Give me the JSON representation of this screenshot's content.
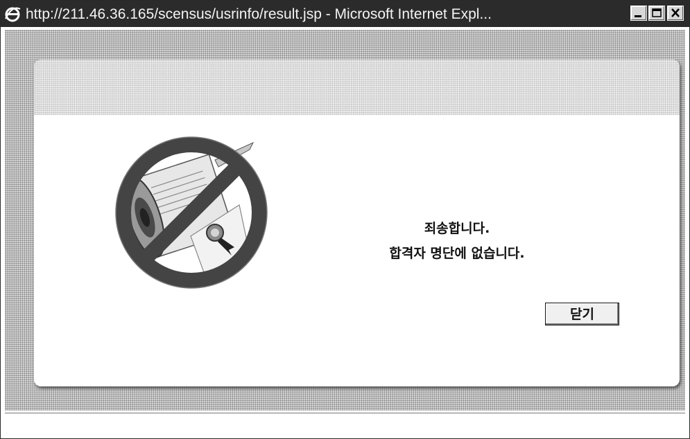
{
  "window": {
    "title": "http://211.46.36.165/scensus/usrinfo/result.jsp - Microsoft Internet Expl..."
  },
  "icons": {
    "app": "internet-explorer-icon",
    "minimize": "minimize-icon",
    "maximize": "maximize-icon",
    "close": "close-icon",
    "illustration": "no-document-prohibited-icon"
  },
  "dialog": {
    "message_line1": "죄송합니다.",
    "message_line2": "합격자 명단에 없습니다.",
    "close_button_label": "닫기"
  },
  "colors": {
    "prohibition_ring": "#444444",
    "title_bar": "#2b2b2b"
  }
}
